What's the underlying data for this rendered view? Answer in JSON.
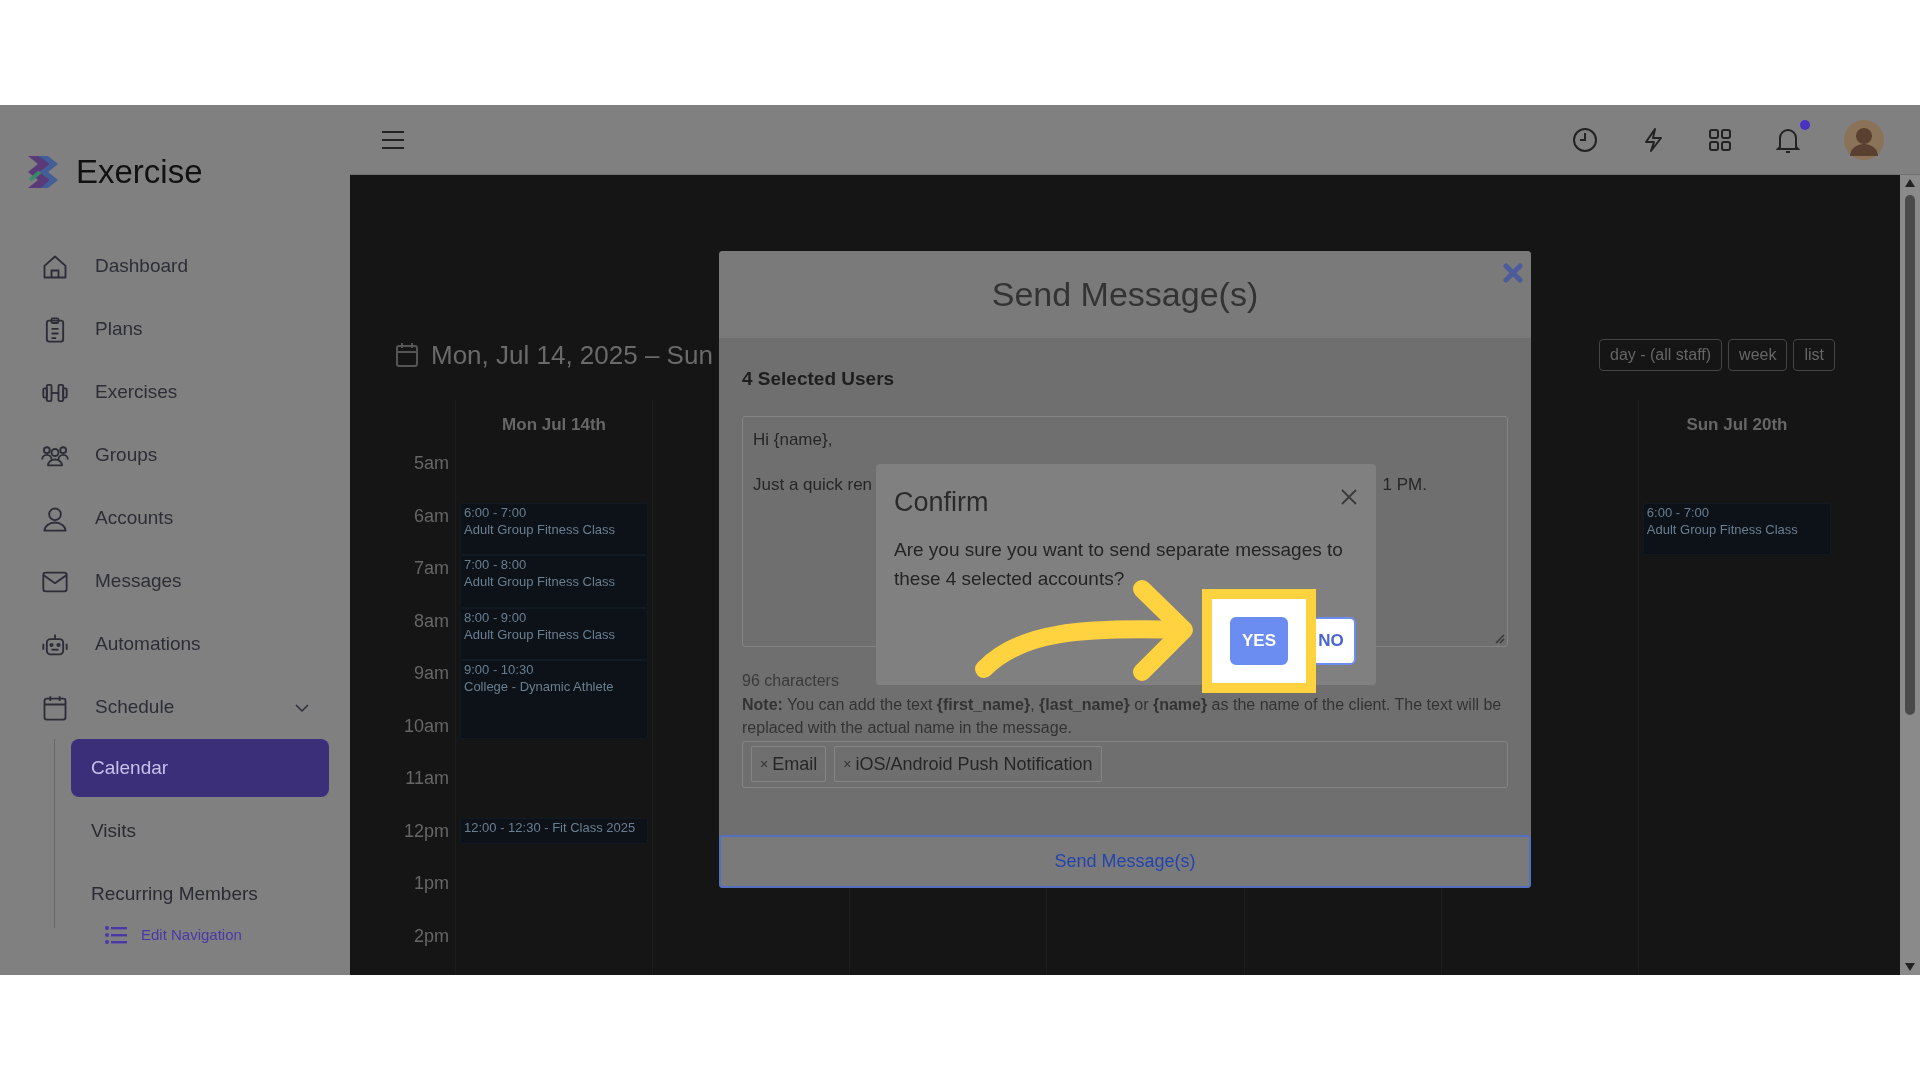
{
  "brand": {
    "name": "Exercise"
  },
  "sidebar": {
    "items": [
      {
        "label": "Dashboard",
        "selected": false
      },
      {
        "label": "Plans",
        "selected": false
      },
      {
        "label": "Exercises",
        "selected": false
      },
      {
        "label": "Groups",
        "selected": false
      },
      {
        "label": "Accounts",
        "selected": false
      },
      {
        "label": "Messages",
        "selected": false
      },
      {
        "label": "Automations",
        "selected": false
      },
      {
        "label": "Schedule",
        "selected": false,
        "expanded": true,
        "children": [
          {
            "label": "Calendar",
            "selected": true
          },
          {
            "label": "Visits",
            "selected": false
          },
          {
            "label": "Recurring Members",
            "selected": false
          }
        ]
      }
    ],
    "edit_link": "Edit Navigation"
  },
  "topbar": {
    "notification_dot": true
  },
  "calendar": {
    "range_title": "Mon, Jul 14, 2025 – Sun",
    "view_buttons": [
      "day - (all staff)",
      "week",
      "list"
    ],
    "times": [
      "5am",
      "6am",
      "7am",
      "8am",
      "9am",
      "10am",
      "11am",
      "12pm",
      "1pm",
      "2pm"
    ],
    "days": [
      {
        "label": "Mon Jul 14th",
        "events": [
          {
            "kind": "empty"
          },
          {
            "kind": "hour",
            "lines": [
              "6:00 - 7:00",
              "Adult Group Fitness Class"
            ]
          },
          {
            "kind": "hour",
            "lines": [
              "7:00 - 8:00",
              "Adult Group Fitness Class"
            ]
          },
          {
            "kind": "hour",
            "lines": [
              "8:00 - 9:00",
              "Adult Group Fitness Class"
            ]
          },
          {
            "kind": "long",
            "lines": [
              "9:00 - 10:30",
              "College - Dynamic Athlete"
            ]
          },
          {
            "kind": "empty_half"
          },
          {
            "kind": "empty"
          },
          {
            "kind": "half",
            "lines": [
              "12:00 - 12:30 - Fit Class 2025"
            ]
          }
        ]
      },
      {
        "label": "Sun Jul 20th",
        "events": [
          {
            "kind": "empty"
          },
          {
            "kind": "hour",
            "lines": [
              "6:00 - 7:00",
              "Adult Group Fitness Class"
            ]
          }
        ]
      }
    ]
  },
  "send_dialog": {
    "title": "Send Message(s)",
    "selected_count": "4 Selected Users",
    "message_first_line": "Hi {name},",
    "message_visible_start": "Just a quick ren",
    "message_visible_end": "1 PM.",
    "char_count": "96 characters",
    "note": "**Note:** You can add the text **{first_name}**, **{last_name}** or **{name}** as the name of the client. The text will be replaced with the actual name in the message.",
    "channels": [
      {
        "remove": "×",
        "label": "Email"
      },
      {
        "remove": "×",
        "label": "iOS/Android Push Notification"
      }
    ],
    "send_button": "Send Message(s)"
  },
  "confirm_dialog": {
    "title": "Confirm",
    "message": "Are you sure you want to send separate messages to these 4 selected accounts?",
    "buttons": [
      {
        "label": "YES",
        "kind": "primary",
        "highlighted": true
      },
      {
        "label": "NO",
        "kind": "outline",
        "highlighted": false
      }
    ]
  }
}
